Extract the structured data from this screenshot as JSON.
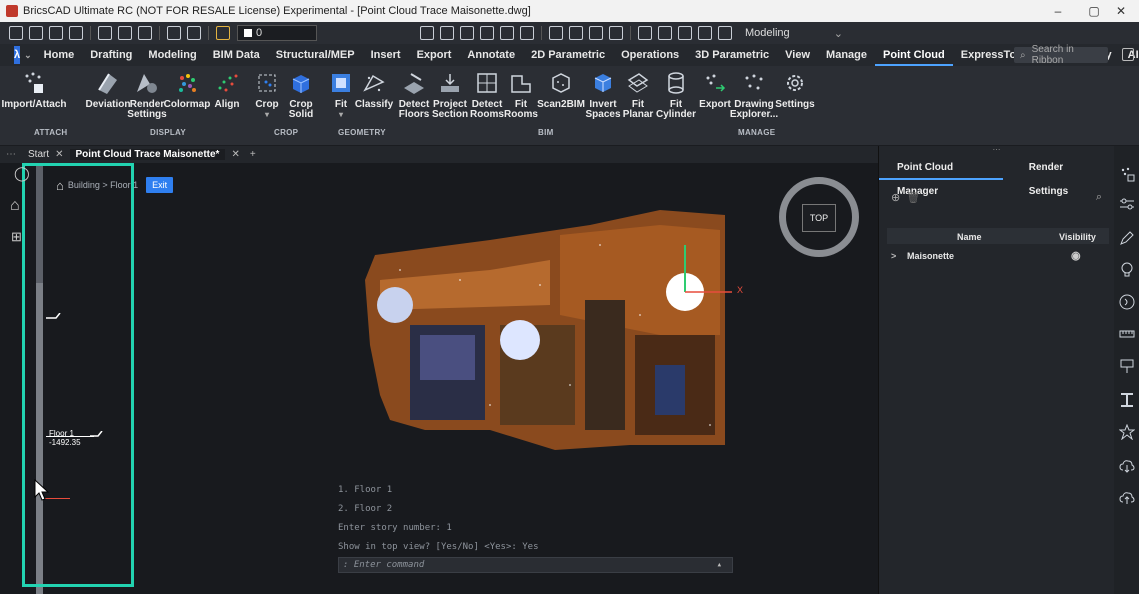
{
  "window": {
    "title": "BricsCAD Ultimate RC (NOT FOR RESALE License) Experimental - [Point Cloud Trace Maisonette.dwg]",
    "minimize": "–",
    "restore": "▢",
    "close": "✕"
  },
  "quick_access": {
    "layer_value": "0",
    "workspace": "Modeling"
  },
  "ribbon_tabs": [
    "Home",
    "Drafting",
    "Modeling",
    "BIM Data",
    "Structural/MEP",
    "Insert",
    "Export",
    "Annotate",
    "2D Parametric",
    "Operations",
    "3D Parametric",
    "View",
    "Manage",
    "Point Cloud",
    "ExpressTools",
    "Productivity",
    "AI Predict"
  ],
  "active_ribbon_tab": "Point Cloud",
  "ribbon_search_placeholder": "Search in Ribbon",
  "ribbon_buttons": {
    "import_attach": "Import/Attach",
    "deviation": "Deviation",
    "render_settings_1": "Render",
    "render_settings_2": "Settings",
    "colormap": "Colormap",
    "align": "Align",
    "crop": "Crop",
    "crop_solid_1": "Crop",
    "crop_solid_2": "Solid",
    "fit": "Fit",
    "classify": "Classify",
    "detect_floors_1": "Detect",
    "detect_floors_2": "Floors",
    "project_section_1": "Project",
    "project_section_2": "Section",
    "detect_rooms_1": "Detect",
    "detect_rooms_2": "Rooms",
    "fit_rooms_1": "Fit",
    "fit_rooms_2": "Rooms",
    "scan2bim": "Scan2BIM",
    "invert_spaces_1": "Invert",
    "invert_spaces_2": "Spaces",
    "fit_planar_1": "Fit",
    "fit_planar_2": "Planar",
    "fit_cylinder_1": "Fit",
    "fit_cylinder_2": "Cylinder",
    "export": "Export",
    "drawing_explorer_1": "Drawing",
    "drawing_explorer_2": "Explorer...",
    "settings": "Settings"
  },
  "ribbon_groups": {
    "attach": "ATTACH",
    "display": "DISPLAY",
    "crop": "CROP",
    "geometry": "GEOMETRY",
    "bim": "BIM",
    "manage": "MANAGE"
  },
  "doc_tabs": {
    "start": "Start",
    "active": "Point Cloud Trace Maisonette*",
    "close": "✕",
    "add": "+"
  },
  "viewport": {
    "breadcrumb": "Building > Floor 1",
    "exit_label": "Exit",
    "floor_name": "Floor 1",
    "floor_elevation": "-1492.35",
    "view_cube_label": "TOP",
    "axis_x": "X"
  },
  "command_history": [
    "1. Floor 1",
    "2. Floor 2",
    "Enter story number: 1",
    "Show in top view? [Yes/No] <Yes>: Yes"
  ],
  "command_prompt": ": Enter command",
  "right_panel": {
    "tabs": [
      "Point Cloud Manager",
      "Render Settings"
    ],
    "active_tab": "Point Cloud Manager",
    "col_name": "Name",
    "col_visibility": "Visibility",
    "rows": [
      {
        "name": "Maisonette",
        "visible": true
      }
    ]
  },
  "colors": {
    "accent": "#4da3ff",
    "highlight_frame": "#22d3b1",
    "exit_button": "#2f7ff0"
  }
}
